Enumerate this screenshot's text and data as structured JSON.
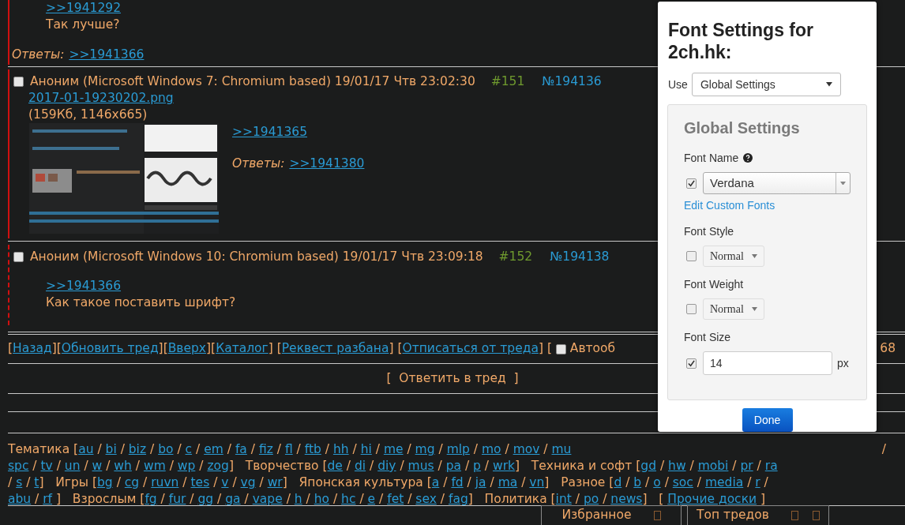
{
  "posts": [
    {
      "highlighted": false,
      "quote": ">>1941292",
      "text": "Так лучше?",
      "replies_label": "Ответы:",
      "replies": [
        ">>1941366"
      ]
    },
    {
      "highlighted": false,
      "header": {
        "checked": false,
        "author": "Аноним (Microsoft Windows 7: Chromium based) 19/01/17 Чтв 23:02:30",
        "num": "#151",
        "id": "№194136"
      },
      "file": {
        "name": "2017-01-19230202.png",
        "info": "(159Кб, 1146x665)"
      },
      "quote": ">>1941365",
      "replies_label": "Ответы:",
      "replies": [
        ">>1941380"
      ]
    },
    {
      "highlighted": true,
      "header": {
        "checked": false,
        "author": "Аноним (Microsoft Windows 10: Chromium based) 19/01/17 Чтв 23:09:18",
        "num": "#152",
        "id": "№194138"
      },
      "quote": ">>1941366",
      "text": "Как такое поставить шрифт?"
    }
  ],
  "nav": {
    "left": [
      {
        "kind": "text",
        "text": "["
      },
      {
        "kind": "link",
        "text": "Назад"
      },
      {
        "kind": "text",
        "text": "]["
      },
      {
        "kind": "link",
        "text": "Обновить тред"
      },
      {
        "kind": "text",
        "text": "]["
      },
      {
        "kind": "link",
        "text": "Вверх"
      },
      {
        "kind": "text",
        "text": "]["
      },
      {
        "kind": "link",
        "text": "Каталог"
      },
      {
        "kind": "text",
        "text": "] ["
      },
      {
        "kind": "link",
        "text": "Реквест разбана"
      },
      {
        "kind": "text",
        "text": "] ["
      },
      {
        "kind": "link",
        "text": "Отписаться от треда"
      },
      {
        "kind": "text",
        "text": "] [ "
      },
      {
        "kind": "checkbox",
        "checked": false
      },
      {
        "kind": "text",
        "text": " Автооб"
      }
    ],
    "right": [
      {
        "kind": "text",
        "text": "68"
      }
    ]
  },
  "reply_button": "[  Ответить в тред  ]",
  "board_lines": [
    {
      "left": [
        {
          "kind": "text",
          "text": "Тематика ["
        },
        {
          "kind": "link",
          "text": "au"
        },
        {
          "kind": "text",
          "text": " / "
        },
        {
          "kind": "link",
          "text": "bi"
        },
        {
          "kind": "text",
          "text": " / "
        },
        {
          "kind": "link",
          "text": "biz"
        },
        {
          "kind": "text",
          "text": " / "
        },
        {
          "kind": "link",
          "text": "bo"
        },
        {
          "kind": "text",
          "text": " / "
        },
        {
          "kind": "link",
          "text": "c"
        },
        {
          "kind": "text",
          "text": " / "
        },
        {
          "kind": "link",
          "text": "em"
        },
        {
          "kind": "text",
          "text": " / "
        },
        {
          "kind": "link",
          "text": "fa"
        },
        {
          "kind": "text",
          "text": " / "
        },
        {
          "kind": "link",
          "text": "fiz"
        },
        {
          "kind": "text",
          "text": " / "
        },
        {
          "kind": "link",
          "text": "fl"
        },
        {
          "kind": "text",
          "text": " / "
        },
        {
          "kind": "link",
          "text": "ftb"
        },
        {
          "kind": "text",
          "text": " / "
        },
        {
          "kind": "link",
          "text": "hh"
        },
        {
          "kind": "text",
          "text": " / "
        },
        {
          "kind": "link",
          "text": "hi"
        },
        {
          "kind": "text",
          "text": " / "
        },
        {
          "kind": "link",
          "text": "me"
        },
        {
          "kind": "text",
          "text": " / "
        },
        {
          "kind": "link",
          "text": "mg"
        },
        {
          "kind": "text",
          "text": " / "
        },
        {
          "kind": "link",
          "text": "mlp"
        },
        {
          "kind": "text",
          "text": " / "
        },
        {
          "kind": "link",
          "text": "mo"
        },
        {
          "kind": "text",
          "text": " / "
        },
        {
          "kind": "link",
          "text": "mov"
        },
        {
          "kind": "text",
          "text": " / "
        },
        {
          "kind": "link",
          "text": "mu"
        }
      ],
      "right": [
        {
          "kind": "text",
          "text": "/"
        }
      ]
    },
    {
      "left": [
        {
          "kind": "link",
          "text": "spc"
        },
        {
          "kind": "text",
          "text": " / "
        },
        {
          "kind": "link",
          "text": "tv"
        },
        {
          "kind": "text",
          "text": " / "
        },
        {
          "kind": "link",
          "text": "un"
        },
        {
          "kind": "text",
          "text": " / "
        },
        {
          "kind": "link",
          "text": "w"
        },
        {
          "kind": "text",
          "text": " / "
        },
        {
          "kind": "link",
          "text": "wh"
        },
        {
          "kind": "text",
          "text": " / "
        },
        {
          "kind": "link",
          "text": "wm"
        },
        {
          "kind": "text",
          "text": " / "
        },
        {
          "kind": "link",
          "text": "wp"
        },
        {
          "kind": "text",
          "text": " / "
        },
        {
          "kind": "link",
          "text": "zog"
        },
        {
          "kind": "text",
          "text": "]   Творчество ["
        },
        {
          "kind": "link",
          "text": "de"
        },
        {
          "kind": "text",
          "text": " / "
        },
        {
          "kind": "link",
          "text": "di"
        },
        {
          "kind": "text",
          "text": " / "
        },
        {
          "kind": "link",
          "text": "diy"
        },
        {
          "kind": "text",
          "text": " / "
        },
        {
          "kind": "link",
          "text": "mus"
        },
        {
          "kind": "text",
          "text": " / "
        },
        {
          "kind": "link",
          "text": "pa"
        },
        {
          "kind": "text",
          "text": " / "
        },
        {
          "kind": "link",
          "text": "p"
        },
        {
          "kind": "text",
          "text": " / "
        },
        {
          "kind": "link",
          "text": "wrk"
        },
        {
          "kind": "text",
          "text": "]   Техника и софт ["
        },
        {
          "kind": "link",
          "text": "gd"
        },
        {
          "kind": "text",
          "text": " / "
        },
        {
          "kind": "link",
          "text": "hw"
        },
        {
          "kind": "text",
          "text": " / "
        },
        {
          "kind": "link",
          "text": "mobi"
        },
        {
          "kind": "text",
          "text": " / "
        },
        {
          "kind": "link",
          "text": "pr"
        },
        {
          "kind": "text",
          "text": " / "
        },
        {
          "kind": "link",
          "text": "ra"
        }
      ]
    },
    {
      "left": [
        {
          "kind": "text",
          "text": "/ "
        },
        {
          "kind": "link",
          "text": "s"
        },
        {
          "kind": "text",
          "text": " / "
        },
        {
          "kind": "link",
          "text": "t"
        },
        {
          "kind": "text",
          "text": "]   Игры ["
        },
        {
          "kind": "link",
          "text": "bg"
        },
        {
          "kind": "text",
          "text": " / "
        },
        {
          "kind": "link",
          "text": "cg"
        },
        {
          "kind": "text",
          "text": " / "
        },
        {
          "kind": "link",
          "text": "ruvn"
        },
        {
          "kind": "text",
          "text": " / "
        },
        {
          "kind": "link",
          "text": "tes"
        },
        {
          "kind": "text",
          "text": " / "
        },
        {
          "kind": "link",
          "text": "v"
        },
        {
          "kind": "text",
          "text": " / "
        },
        {
          "kind": "link",
          "text": "vg"
        },
        {
          "kind": "text",
          "text": " / "
        },
        {
          "kind": "link",
          "text": "wr"
        },
        {
          "kind": "text",
          "text": "]   Японская культура ["
        },
        {
          "kind": "link",
          "text": "a"
        },
        {
          "kind": "text",
          "text": " / "
        },
        {
          "kind": "link",
          "text": "fd"
        },
        {
          "kind": "text",
          "text": " / "
        },
        {
          "kind": "link",
          "text": "ja"
        },
        {
          "kind": "text",
          "text": " / "
        },
        {
          "kind": "link",
          "text": "ma"
        },
        {
          "kind": "text",
          "text": " / "
        },
        {
          "kind": "link",
          "text": "vn"
        },
        {
          "kind": "text",
          "text": "]   Разное ["
        },
        {
          "kind": "link",
          "text": "d"
        },
        {
          "kind": "text",
          "text": " / "
        },
        {
          "kind": "link",
          "text": "b"
        },
        {
          "kind": "text",
          "text": " / "
        },
        {
          "kind": "link",
          "text": "o"
        },
        {
          "kind": "text",
          "text": " / "
        },
        {
          "kind": "link",
          "text": "soc"
        },
        {
          "kind": "text",
          "text": " / "
        },
        {
          "kind": "link",
          "text": "media"
        },
        {
          "kind": "text",
          "text": " / "
        },
        {
          "kind": "link",
          "text": "r"
        },
        {
          "kind": "text",
          "text": " /"
        }
      ]
    },
    {
      "left": [
        {
          "kind": "link",
          "text": "abu"
        },
        {
          "kind": "text",
          "text": " / "
        },
        {
          "kind": "link",
          "text": "rf"
        },
        {
          "kind": "text",
          "text": " ]   Взрослым ["
        },
        {
          "kind": "link",
          "text": "fg"
        },
        {
          "kind": "text",
          "text": " / "
        },
        {
          "kind": "link",
          "text": "fur"
        },
        {
          "kind": "text",
          "text": " / "
        },
        {
          "kind": "link",
          "text": "gg"
        },
        {
          "kind": "text",
          "text": " / "
        },
        {
          "kind": "link",
          "text": "ga"
        },
        {
          "kind": "text",
          "text": " / "
        },
        {
          "kind": "link",
          "text": "vape"
        },
        {
          "kind": "text",
          "text": " / "
        },
        {
          "kind": "link",
          "text": "h"
        },
        {
          "kind": "text",
          "text": " / "
        },
        {
          "kind": "link",
          "text": "ho"
        },
        {
          "kind": "text",
          "text": " / "
        },
        {
          "kind": "link",
          "text": "hc"
        },
        {
          "kind": "text",
          "text": " / "
        },
        {
          "kind": "link",
          "text": "e"
        },
        {
          "kind": "text",
          "text": " / "
        },
        {
          "kind": "link",
          "text": "fet"
        },
        {
          "kind": "text",
          "text": " / "
        },
        {
          "kind": "link",
          "text": "sex"
        },
        {
          "kind": "text",
          "text": " / "
        },
        {
          "kind": "link",
          "text": "fag"
        },
        {
          "kind": "text",
          "text": "]   Политика ["
        },
        {
          "kind": "link",
          "text": "int"
        },
        {
          "kind": "text",
          "text": " / "
        },
        {
          "kind": "link",
          "text": "po"
        },
        {
          "kind": "text",
          "text": " / "
        },
        {
          "kind": "link",
          "text": "news"
        },
        {
          "kind": "text",
          "text": "]   [ "
        },
        {
          "kind": "link",
          "text": "Прочие доски"
        },
        {
          "kind": "text",
          "text": " ]"
        }
      ]
    }
  ],
  "bottom_tabs": [
    {
      "label": "Избранное",
      "kind": "favorites"
    },
    {
      "label": "Топ тредов",
      "kind": "top"
    }
  ],
  "popup": {
    "title": "Font Settings for 2ch.hk:",
    "use_label": "Use",
    "use_value": "Global Settings",
    "panel_title": "Global Settings",
    "settings": [
      {
        "kind": "combo",
        "label": "Font Name",
        "help": true,
        "checked": true,
        "value": "Verdana",
        "link": "Edit Custom Fonts"
      },
      {
        "kind": "select",
        "label": "Font Style",
        "checked": false,
        "value": "Normal"
      },
      {
        "kind": "select",
        "label": "Font Weight",
        "checked": false,
        "value": "Normal"
      },
      {
        "kind": "input",
        "label": "Font Size",
        "checked": true,
        "value": "14",
        "unit": "px"
      }
    ],
    "done": "Done"
  }
}
